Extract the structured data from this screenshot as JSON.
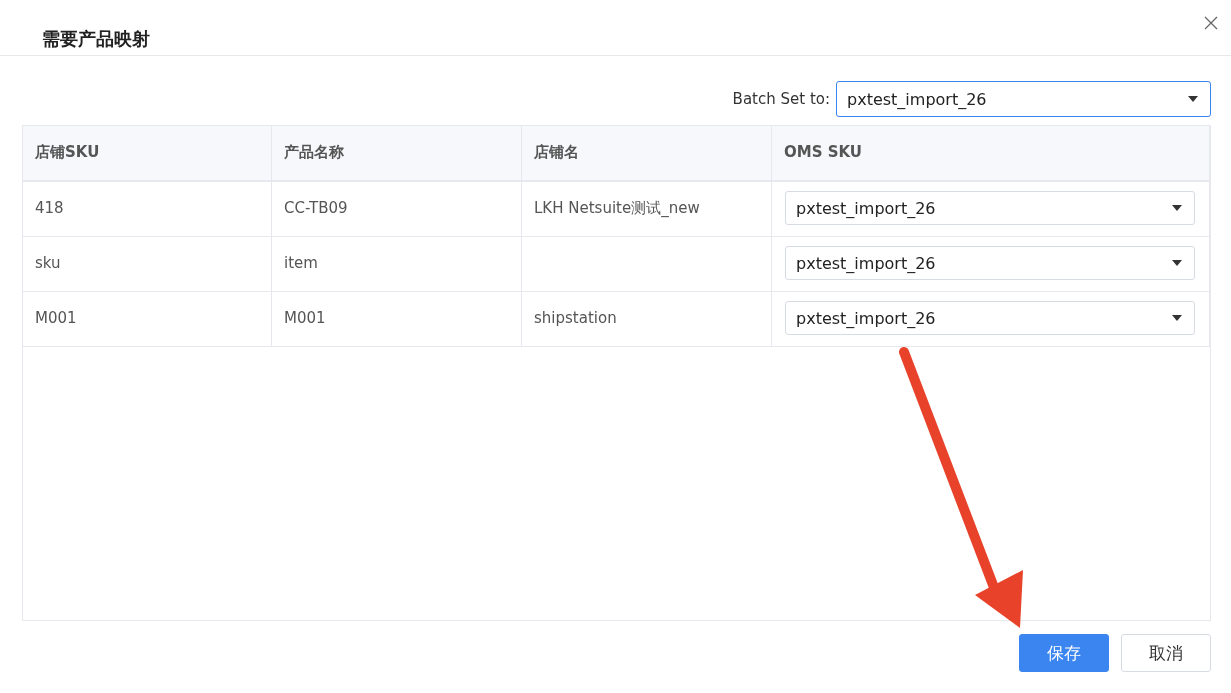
{
  "dialog": {
    "title": "需要产品映射"
  },
  "batch_set": {
    "label": "Batch Set to:",
    "value": "pxtest_import_26",
    "focused": true
  },
  "table": {
    "columns": [
      "店铺SKU",
      "产品名称",
      "店铺名",
      "OMS SKU"
    ],
    "rows": [
      {
        "store_sku": "418",
        "product_name": "CC-TB09",
        "store_name": "LKH Netsuite测试_new",
        "oms_sku": "pxtest_import_26"
      },
      {
        "store_sku": "sku",
        "product_name": "item",
        "oms_sku": "pxtest_import_26"
      },
      {
        "store_sku": "M001",
        "product_name": "M001",
        "store_name": "shipstation",
        "oms_sku": "pxtest_import_26"
      }
    ]
  },
  "buttons": [
    {
      "label": "保存",
      "kind": "primary"
    },
    {
      "label": "取消",
      "kind": "default"
    }
  ]
}
